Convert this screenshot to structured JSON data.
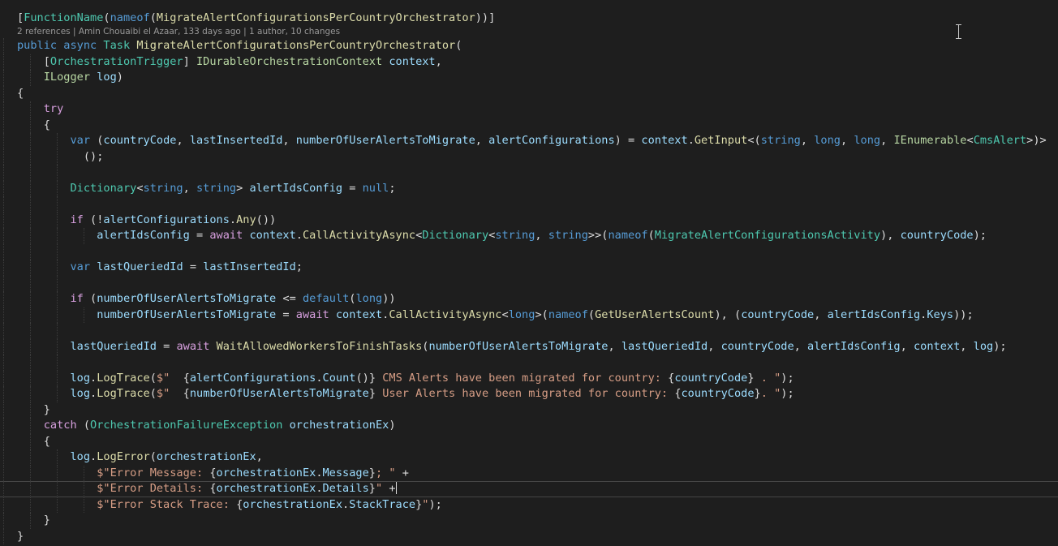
{
  "codelens": "2 references | Amin Chouaibi el Azaar, 133 days ago | 1 author, 10 changes",
  "lines": [
    [
      [
        "p",
        "["
      ],
      [
        "t",
        "FunctionName"
      ],
      [
        "p",
        "("
      ],
      [
        "k",
        "nameof"
      ],
      [
        "p",
        "("
      ],
      [
        "m",
        "MigrateAlertConfigurationsPerCountryOrchestrator"
      ],
      [
        "p",
        "))]"
      ]
    ],
    [
      [
        "k",
        "public"
      ],
      [
        "p",
        " "
      ],
      [
        "k",
        "async"
      ],
      [
        "p",
        " "
      ],
      [
        "t",
        "Task"
      ],
      [
        "p",
        " "
      ],
      [
        "m",
        "MigrateAlertConfigurationsPerCountryOrchestrator"
      ],
      [
        "p",
        "("
      ]
    ],
    [
      [
        "p",
        "    ["
      ],
      [
        "t",
        "OrchestrationTrigger"
      ],
      [
        "p",
        "] "
      ],
      [
        "i",
        "IDurableOrchestrationContext"
      ],
      [
        "p",
        " "
      ],
      [
        "v",
        "context"
      ],
      [
        "p",
        ","
      ]
    ],
    [
      [
        "p",
        "    "
      ],
      [
        "i",
        "ILogger"
      ],
      [
        "p",
        " "
      ],
      [
        "v",
        "log"
      ],
      [
        "p",
        ")"
      ]
    ],
    [
      [
        "p",
        "{"
      ]
    ],
    [
      [
        "p",
        "    "
      ],
      [
        "ctl",
        "try"
      ]
    ],
    [
      [
        "p",
        "    {"
      ]
    ],
    [
      [
        "p",
        "        "
      ],
      [
        "k",
        "var"
      ],
      [
        "p",
        " ("
      ],
      [
        "v",
        "countryCode"
      ],
      [
        "p",
        ", "
      ],
      [
        "v",
        "lastInsertedId"
      ],
      [
        "p",
        ", "
      ],
      [
        "v",
        "numberOfUserAlertsToMigrate"
      ],
      [
        "p",
        ", "
      ],
      [
        "v",
        "alertConfigurations"
      ],
      [
        "p",
        ") = "
      ],
      [
        "v",
        "context"
      ],
      [
        "p",
        "."
      ],
      [
        "m",
        "GetInput"
      ],
      [
        "p",
        "<("
      ],
      [
        "k",
        "string"
      ],
      [
        "p",
        ", "
      ],
      [
        "k",
        "long"
      ],
      [
        "p",
        ", "
      ],
      [
        "k",
        "long"
      ],
      [
        "p",
        ", "
      ],
      [
        "i",
        "IEnumerable"
      ],
      [
        "p",
        "<"
      ],
      [
        "t",
        "CmsAlert"
      ],
      [
        "p",
        ">)>"
      ]
    ],
    [
      [
        "p",
        "          ();"
      ]
    ],
    [
      [
        "p",
        ""
      ]
    ],
    [
      [
        "p",
        "        "
      ],
      [
        "t",
        "Dictionary"
      ],
      [
        "p",
        "<"
      ],
      [
        "k",
        "string"
      ],
      [
        "p",
        ", "
      ],
      [
        "k",
        "string"
      ],
      [
        "p",
        "> "
      ],
      [
        "v",
        "alertIdsConfig"
      ],
      [
        "p",
        " = "
      ],
      [
        "k",
        "null"
      ],
      [
        "p",
        ";"
      ]
    ],
    [
      [
        "p",
        ""
      ]
    ],
    [
      [
        "p",
        "        "
      ],
      [
        "ctl",
        "if"
      ],
      [
        "p",
        " (!"
      ],
      [
        "v",
        "alertConfigurations"
      ],
      [
        "p",
        "."
      ],
      [
        "m",
        "Any"
      ],
      [
        "p",
        "())"
      ]
    ],
    [
      [
        "p",
        "            "
      ],
      [
        "v",
        "alertIdsConfig"
      ],
      [
        "p",
        " = "
      ],
      [
        "ctl",
        "await"
      ],
      [
        "p",
        " "
      ],
      [
        "v",
        "context"
      ],
      [
        "p",
        "."
      ],
      [
        "m",
        "CallActivityAsync"
      ],
      [
        "p",
        "<"
      ],
      [
        "t",
        "Dictionary"
      ],
      [
        "p",
        "<"
      ],
      [
        "k",
        "string"
      ],
      [
        "p",
        ", "
      ],
      [
        "k",
        "string"
      ],
      [
        "p",
        ">>("
      ],
      [
        "k",
        "nameof"
      ],
      [
        "p",
        "("
      ],
      [
        "t",
        "MigrateAlertConfigurationsActivity"
      ],
      [
        "p",
        "), "
      ],
      [
        "v",
        "countryCode"
      ],
      [
        "p",
        ");"
      ]
    ],
    [
      [
        "p",
        ""
      ]
    ],
    [
      [
        "p",
        "        "
      ],
      [
        "k",
        "var"
      ],
      [
        "p",
        " "
      ],
      [
        "v",
        "lastQueriedId"
      ],
      [
        "p",
        " = "
      ],
      [
        "v",
        "lastInsertedId"
      ],
      [
        "p",
        ";"
      ]
    ],
    [
      [
        "p",
        ""
      ]
    ],
    [
      [
        "p",
        "        "
      ],
      [
        "ctl",
        "if"
      ],
      [
        "p",
        " ("
      ],
      [
        "v",
        "numberOfUserAlertsToMigrate"
      ],
      [
        "p",
        " <= "
      ],
      [
        "k",
        "default"
      ],
      [
        "p",
        "("
      ],
      [
        "k",
        "long"
      ],
      [
        "p",
        "))"
      ]
    ],
    [
      [
        "p",
        "            "
      ],
      [
        "v",
        "numberOfUserAlertsToMigrate"
      ],
      [
        "p",
        " = "
      ],
      [
        "ctl",
        "await"
      ],
      [
        "p",
        " "
      ],
      [
        "v",
        "context"
      ],
      [
        "p",
        "."
      ],
      [
        "m",
        "CallActivityAsync"
      ],
      [
        "p",
        "<"
      ],
      [
        "k",
        "long"
      ],
      [
        "p",
        ">("
      ],
      [
        "k",
        "nameof"
      ],
      [
        "p",
        "("
      ],
      [
        "m",
        "GetUserAlertsCount"
      ],
      [
        "p",
        "), ("
      ],
      [
        "v",
        "countryCode"
      ],
      [
        "p",
        ", "
      ],
      [
        "v",
        "alertIdsConfig"
      ],
      [
        "p",
        "."
      ],
      [
        "v",
        "Keys"
      ],
      [
        "p",
        "));"
      ]
    ],
    [
      [
        "p",
        ""
      ]
    ],
    [
      [
        "p",
        "        "
      ],
      [
        "v",
        "lastQueriedId"
      ],
      [
        "p",
        " = "
      ],
      [
        "ctl",
        "await"
      ],
      [
        "p",
        " "
      ],
      [
        "m",
        "WaitAllowedWorkersToFinishTasks"
      ],
      [
        "p",
        "("
      ],
      [
        "v",
        "numberOfUserAlertsToMigrate"
      ],
      [
        "p",
        ", "
      ],
      [
        "v",
        "lastQueriedId"
      ],
      [
        "p",
        ", "
      ],
      [
        "v",
        "countryCode"
      ],
      [
        "p",
        ", "
      ],
      [
        "v",
        "alertIdsConfig"
      ],
      [
        "p",
        ", "
      ],
      [
        "v",
        "context"
      ],
      [
        "p",
        ", "
      ],
      [
        "v",
        "log"
      ],
      [
        "p",
        ");"
      ]
    ],
    [
      [
        "p",
        ""
      ]
    ],
    [
      [
        "p",
        "        "
      ],
      [
        "v",
        "log"
      ],
      [
        "p",
        "."
      ],
      [
        "m",
        "LogTrace"
      ],
      [
        "p",
        "("
      ],
      [
        "s",
        "$\"  "
      ],
      [
        "p",
        "{"
      ],
      [
        "v",
        "alertConfigurations"
      ],
      [
        "p",
        "."
      ],
      [
        "v",
        "Count"
      ],
      [
        "p",
        "()}"
      ],
      [
        "s",
        " CMS Alerts have been migrated for country: "
      ],
      [
        "p",
        "{"
      ],
      [
        "v",
        "countryCode"
      ],
      [
        "p",
        "}"
      ],
      [
        "s",
        " . \""
      ],
      [
        "p",
        ");"
      ]
    ],
    [
      [
        "p",
        "        "
      ],
      [
        "v",
        "log"
      ],
      [
        "p",
        "."
      ],
      [
        "m",
        "LogTrace"
      ],
      [
        "p",
        "("
      ],
      [
        "s",
        "$\"  "
      ],
      [
        "p",
        "{"
      ],
      [
        "v",
        "numberOfUserAlertsToMigrate"
      ],
      [
        "p",
        "}"
      ],
      [
        "s",
        " User Alerts have been migrated for country: "
      ],
      [
        "p",
        "{"
      ],
      [
        "v",
        "countryCode"
      ],
      [
        "p",
        "}"
      ],
      [
        "s",
        ". \""
      ],
      [
        "p",
        ");"
      ]
    ],
    [
      [
        "p",
        "    }"
      ]
    ],
    [
      [
        "p",
        "    "
      ],
      [
        "ctl",
        "catch"
      ],
      [
        "p",
        " ("
      ],
      [
        "t",
        "OrchestrationFailureException"
      ],
      [
        "p",
        " "
      ],
      [
        "v",
        "orchestrationEx"
      ],
      [
        "p",
        ")"
      ]
    ],
    [
      [
        "p",
        "    {"
      ]
    ],
    [
      [
        "p",
        "        "
      ],
      [
        "v",
        "log"
      ],
      [
        "p",
        "."
      ],
      [
        "m",
        "LogError"
      ],
      [
        "p",
        "("
      ],
      [
        "v",
        "orchestrationEx"
      ],
      [
        "p",
        ","
      ]
    ],
    [
      [
        "p",
        "            "
      ],
      [
        "s",
        "$\"Error Message: "
      ],
      [
        "p",
        "{"
      ],
      [
        "v",
        "orchestrationEx"
      ],
      [
        "p",
        "."
      ],
      [
        "v",
        "Message"
      ],
      [
        "p",
        "}"
      ],
      [
        "s",
        "; \""
      ],
      [
        "p",
        " +"
      ]
    ],
    [
      [
        "p",
        "            "
      ],
      [
        "s",
        "$\"Error Details: "
      ],
      [
        "p",
        "{"
      ],
      [
        "v",
        "orchestrationEx"
      ],
      [
        "p",
        "."
      ],
      [
        "v",
        "Details"
      ],
      [
        "p",
        "}"
      ],
      [
        "s",
        "\""
      ],
      [
        "p",
        " +"
      ]
    ],
    [
      [
        "p",
        "            "
      ],
      [
        "s",
        "$\"Error Stack Trace: "
      ],
      [
        "p",
        "{"
      ],
      [
        "v",
        "orchestrationEx"
      ],
      [
        "p",
        "."
      ],
      [
        "v",
        "StackTrace"
      ],
      [
        "p",
        "}"
      ],
      [
        "s",
        "\""
      ],
      [
        "p",
        ");"
      ]
    ],
    [
      [
        "p",
        "    }"
      ]
    ],
    [
      [
        "p",
        "}"
      ]
    ]
  ]
}
